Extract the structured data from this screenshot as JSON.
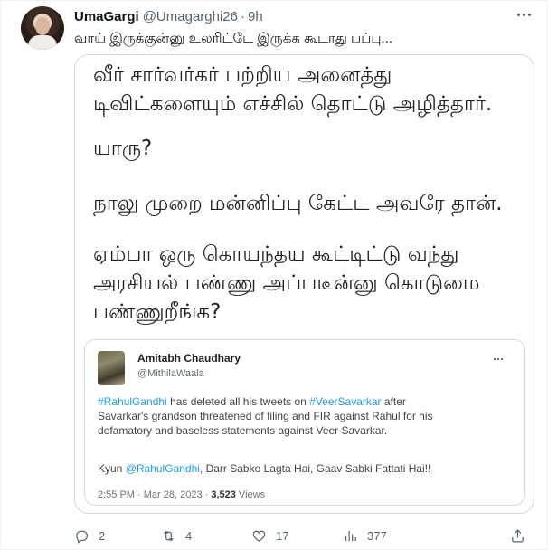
{
  "tweet": {
    "display_name": "UmaGargi",
    "handle": "@Umagarghi26",
    "separator": "·",
    "time": "9h",
    "text": "வாய் இருக்குன்னு உலரிட்டே இருக்க கூடாது பப்பு..."
  },
  "image": {
    "lines": [
      "வீர் சார்வர்கர் பற்றிய அனைத்து",
      "டிவிட்களையும் எச்சில் தொட்டு அழித்தார்.",
      "",
      "யாரு?",
      "",
      "நாலு முறை மன்னிப்பு கேட்ட அவரே தான்.",
      "",
      "ஏம்பா ஒரு கொயந்தய கூட்டிட்டு வந்து",
      "அரசியல் பண்ணு அப்படீன்னு கொடுமை",
      "பண்ணுறீங்க?"
    ],
    "quoted": {
      "name": "Amitabh Chaudhary",
      "handle": "@MithilaWaala",
      "mention_rahul": "#RahulGandhi",
      "text_1": " has deleted all his tweets on ",
      "mention_savarkar": "#VeerSavarkar",
      "text_2": " after",
      "line_2": "Savarkar's grandson threatened of filing and FIR against Rahul for his",
      "line_3": "defamatory and baseless statements against Veer Savarkar.",
      "reply_prefix": "Kyun ",
      "reply_mention": "@RahulGandhi",
      "reply_rest": ", Darr Sabko Lagta Hai, Gaav Sabki Fattati Hai!!",
      "timestamp": "2:55 PM · Mar 28, 2023 · ",
      "views_count": "3,523",
      "views_label": " Views"
    }
  },
  "actions": {
    "replies": "2",
    "retweets": "4",
    "likes": "17",
    "views": "377"
  },
  "colors": {
    "accent": "#1d9bf0",
    "secondary_text": "#536471",
    "primary_text": "#0f1419",
    "border": "#cfd9de"
  },
  "icons": [
    "more-icon",
    "reply-icon",
    "retweet-icon",
    "like-icon",
    "views-icon",
    "share-icon"
  ]
}
